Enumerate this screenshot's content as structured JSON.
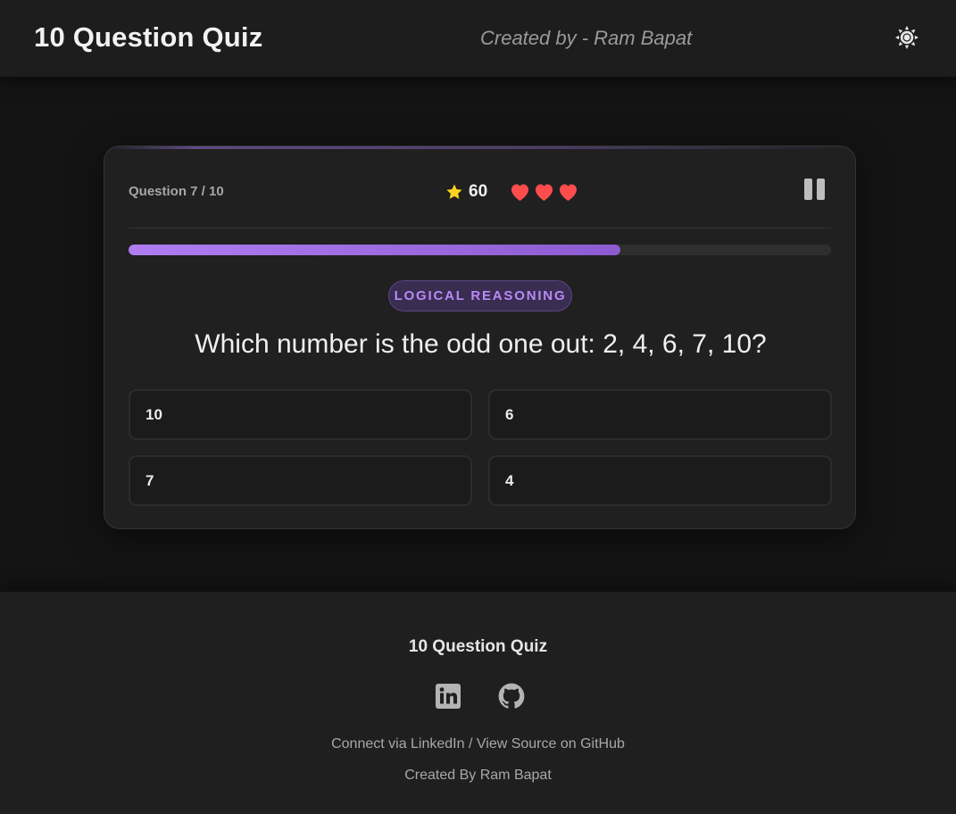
{
  "header": {
    "title": "10 Question Quiz",
    "subtitle": "Created by - Ram Bapat",
    "theme_icon": "sun-icon"
  },
  "quiz": {
    "counter": "Question 7 / 10",
    "score": "60",
    "score_icon": "star-icon",
    "lives": 3,
    "progress_percent": 70,
    "category": "LOGICAL REASONING",
    "question": "Which number is the odd one out: 2, 4, 6, 7, 10?",
    "options": [
      "10",
      "6",
      "7",
      "4"
    ]
  },
  "footer": {
    "title": "10 Question Quiz",
    "link_linkedin": "Connect via LinkedIn",
    "separator": " / ",
    "link_github": "View Source on GitHub",
    "credit": "Created By Ram Bapat"
  },
  "colors": {
    "accent": "#b07cf2",
    "heart": "#ff4d4d",
    "star": "#ffd21f"
  }
}
